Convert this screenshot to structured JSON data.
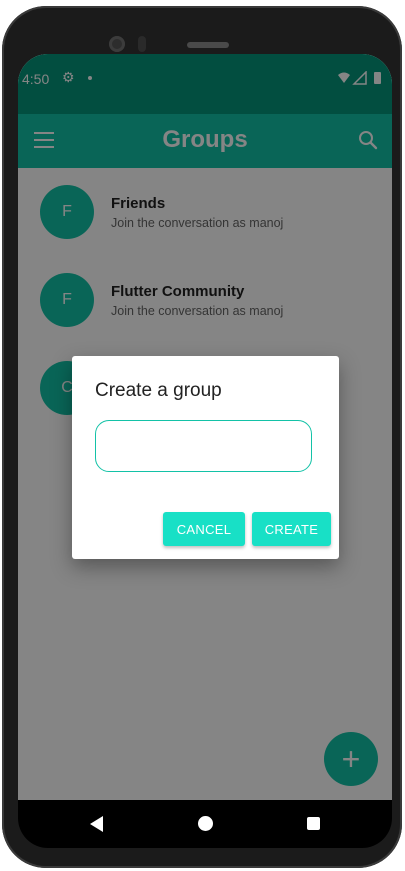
{
  "status_bar": {
    "time": "4:50",
    "gear_icon": "gear-icon",
    "background": "#04967c"
  },
  "app_bar": {
    "title": "Groups",
    "menu_icon": "menu-icon",
    "search_icon": "search-icon",
    "background": "#13c2a7"
  },
  "groups": [
    {
      "initial": "F",
      "name": "Friends",
      "subtitle": "Join the conversation as manoj"
    },
    {
      "initial": "F",
      "name": "Flutter Community",
      "subtitle": "Join the conversation as manoj"
    },
    {
      "initial": "C",
      "name": "",
      "subtitle": ""
    }
  ],
  "fab": {
    "icon": "plus-icon",
    "label": "+"
  },
  "dialog": {
    "title": "Create a group",
    "input_value": "",
    "input_placeholder": "",
    "cancel_label": "CANCEL",
    "create_label": "CREATE",
    "button_color": "#18e0c6"
  },
  "nav_bar": {
    "back_icon": "back-icon",
    "home_icon": "home-icon",
    "recents_icon": "recents-icon"
  }
}
